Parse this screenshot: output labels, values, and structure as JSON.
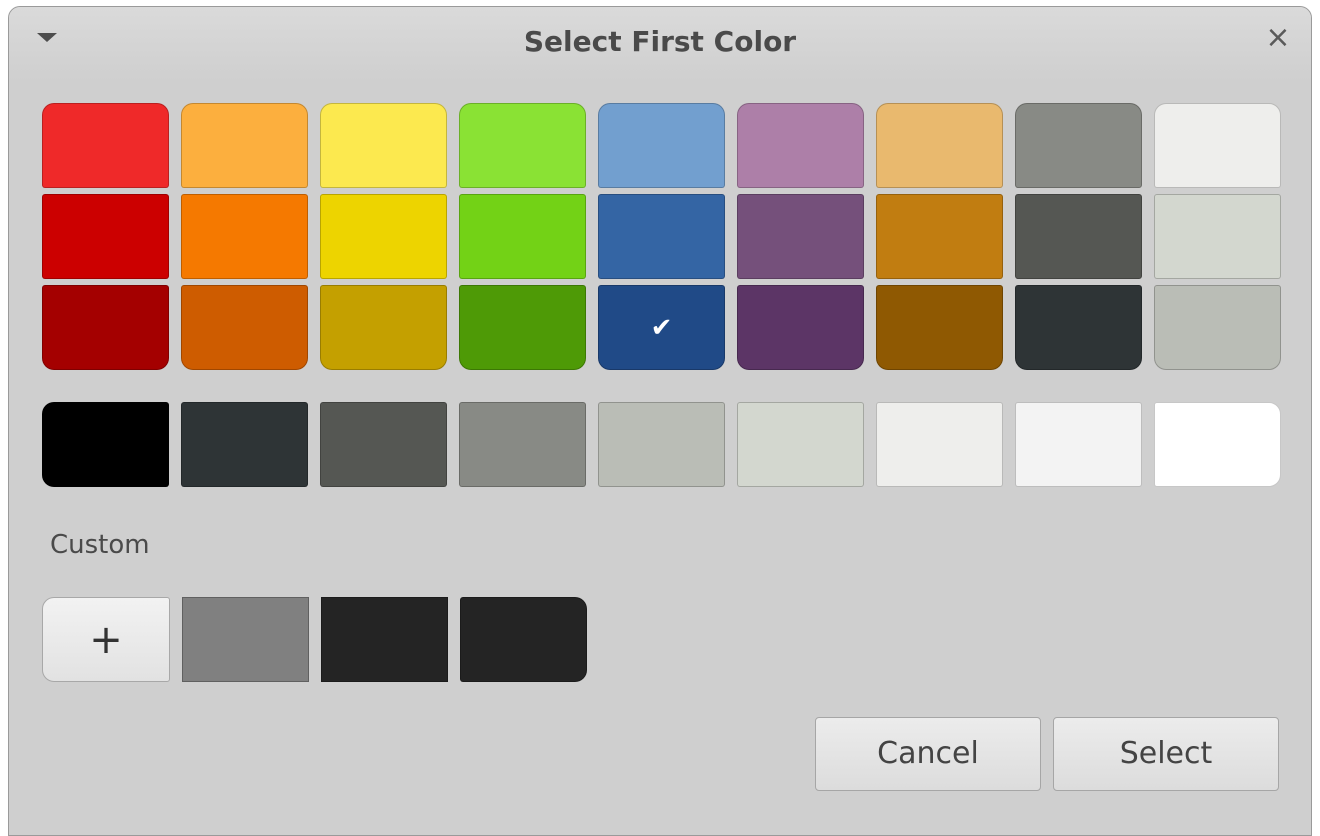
{
  "window": {
    "title": "Select First Color",
    "close_glyph": "×",
    "menu_icon": "triangle-down-icon"
  },
  "palette": {
    "rows": [
      [
        "#ef2929",
        "#fcaf3e",
        "#fce94f",
        "#8ae234",
        "#729fcf",
        "#ad7fa8",
        "#e9b96e",
        "#888a85",
        "#eeeeec"
      ],
      [
        "#cc0000",
        "#f57900",
        "#edd400",
        "#73d216",
        "#3465a4",
        "#75507b",
        "#c17d11",
        "#555753",
        "#d3d7cf"
      ],
      [
        "#a40000",
        "#ce5c00",
        "#c4a000",
        "#4e9a06",
        "#204a87",
        "#5c3566",
        "#8f5902",
        "#2e3436",
        "#babdb6"
      ]
    ],
    "selected": {
      "row": 2,
      "col": 4
    },
    "check_glyph": "✔",
    "grays": [
      "#000000",
      "#2e3436",
      "#555753",
      "#888a85",
      "#babdb6",
      "#d3d7cf",
      "#eeeeec",
      "#f3f3f3",
      "#ffffff"
    ]
  },
  "custom": {
    "label": "Custom",
    "add_label": "+",
    "colors": [
      "#808080",
      "#242424",
      "#242424"
    ]
  },
  "buttons": {
    "cancel": "Cancel",
    "select": "Select"
  }
}
